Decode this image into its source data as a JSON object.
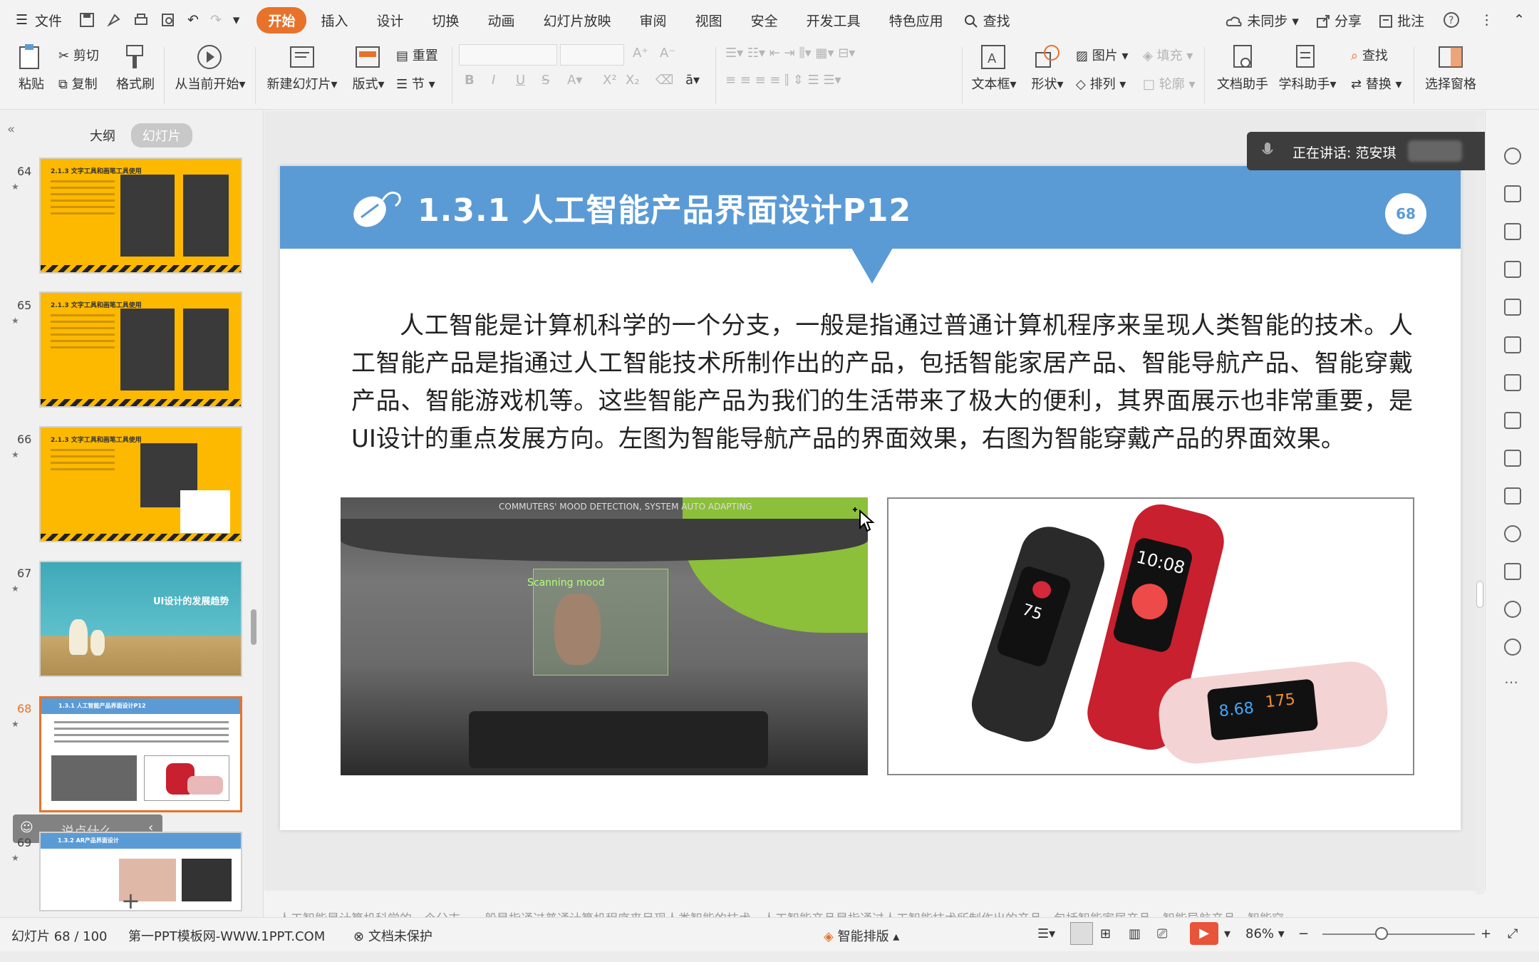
{
  "menubar": {
    "items": [
      "文件",
      "开始",
      "插入",
      "设计",
      "切换",
      "动画",
      "幻灯片放映",
      "审阅",
      "视图",
      "安全",
      "开发工具",
      "特色应用",
      "查找"
    ],
    "active_index": 1,
    "right_items": [
      "未同步",
      "分享",
      "批注"
    ]
  },
  "ribbon": {
    "paste": "粘贴",
    "cut": "剪切",
    "copy": "复制",
    "format_painter": "格式刷",
    "play_from_current": "从当前开始",
    "new_slide": "新建幻灯片",
    "layout": "版式",
    "reset": "重置",
    "section": "节",
    "textbox": "文本框",
    "shape": "形状",
    "picture": "图片",
    "fill": "填充",
    "arrange": "排列",
    "outline": "轮廓",
    "doc_assistant": "文档助手",
    "subject_assistant": "学科助手",
    "find": "查找",
    "replace": "替换",
    "select_pane": "选择窗格"
  },
  "leftpanel": {
    "tab_outline": "大纲",
    "tab_slides": "幻灯片",
    "thumbnails": [
      {
        "num": "64",
        "title": "2.1.3 文字工具和画笔工具使用",
        "style": "yellow"
      },
      {
        "num": "65",
        "title": "2.1.3 文字工具和画笔工具使用",
        "style": "yellow"
      },
      {
        "num": "66",
        "title": "2.1.3 文字工具和画笔工具使用",
        "style": "yellow"
      },
      {
        "num": "67",
        "title": "UI设计的发展趋势",
        "style": "teal"
      },
      {
        "num": "68",
        "title": "1.3.1 人工智能产品界面设计P12",
        "style": "current"
      },
      {
        "num": "69",
        "title": "1.3.2 AR产品界面设计",
        "style": "blue"
      }
    ],
    "comment_placeholder": "说点什么..."
  },
  "slide": {
    "title": "1.3.1  人工智能产品界面设计P12",
    "page_number": "68",
    "body": "人工智能是计算机科学的一个分支，一般是指通过普通计算机程序来呈现人类智能的技术。人工智能产品是指通过人工智能技术所制作出的产品，包括智能家居产品、智能导航产品、智能穿戴产品、智能游戏机等。这些智能产品为我们的生活带来了极大的便利，其界面展示也非常重要，是UI设计的重点发展方向。左图为智能导航产品的界面效果，右图为智能穿戴产品的界面效果。",
    "image_left_caption": "COMMUTERS' MOOD DETECTION, SYSTEM AUTO ADAPTING",
    "image_left_overlay": "Scanning mood",
    "watch1_value": "75",
    "watch2_time": "10:08",
    "watch3_value": "175",
    "watch3_value2": "8.68"
  },
  "speaking": {
    "label": "正在讲话: 范安琪"
  },
  "notes_preview": "人工智能是计算机科学的一个分支，一般是指通过普通计算机程序来呈现人类智能的技术。人工智能产品是指通过人工智能技术所制作出的产品，包括智能家居产品、智能导航产品、智能穿...",
  "statusbar": {
    "slide_counter": "幻灯片 68 / 100",
    "template": "第一PPT模板网-WWW.1PPT.COM",
    "doc_protect": "文档未保护",
    "smart_layout": "智能排版",
    "zoom": "86%"
  },
  "colors": {
    "accent_orange": "#e8722a",
    "slide_blue": "#5b9bd5",
    "thumb_yellow": "#fcb900"
  }
}
